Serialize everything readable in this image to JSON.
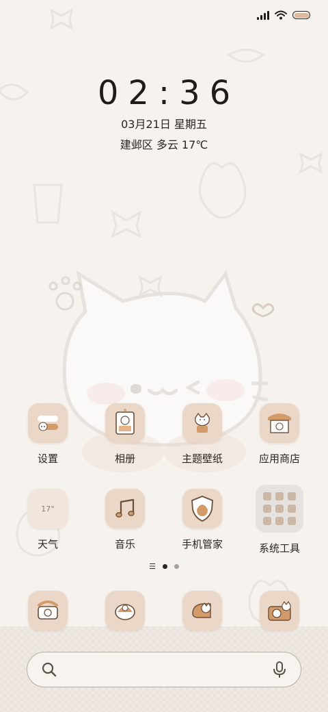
{
  "status_bar": {
    "icons": [
      "signal-icon",
      "wifi-icon",
      "battery-icon"
    ],
    "battery_color": "#e0b79b"
  },
  "clock": {
    "time": "02:36",
    "date": "03月21日 星期五",
    "weather": "建邺区 多云 17℃"
  },
  "apps_row1": [
    {
      "label": "设置",
      "icon": "settings-icon"
    },
    {
      "label": "相册",
      "icon": "gallery-icon"
    },
    {
      "label": "主题壁纸",
      "icon": "themes-icon"
    },
    {
      "label": "应用商店",
      "icon": "app-store-icon"
    }
  ],
  "apps_row2": [
    {
      "label": "天气",
      "icon": "weather-icon",
      "tile_text": "17°"
    },
    {
      "label": "音乐",
      "icon": "music-icon"
    },
    {
      "label": "手机管家",
      "icon": "security-icon"
    },
    {
      "label": "系统工具",
      "icon": "folder-icon"
    }
  ],
  "dock": [
    {
      "icon": "phone-icon"
    },
    {
      "icon": "messages-icon"
    },
    {
      "icon": "browser-icon"
    },
    {
      "icon": "camera-icon"
    }
  ],
  "page_indicator": {
    "pages": 2,
    "active": 0
  },
  "search": {
    "icons": [
      "search-icon",
      "microphone-icon"
    ]
  },
  "colors": {
    "background": "#f6f2ee",
    "tile": "#ead7c7",
    "accent": "#d9a97e",
    "text": "#2a2522"
  }
}
